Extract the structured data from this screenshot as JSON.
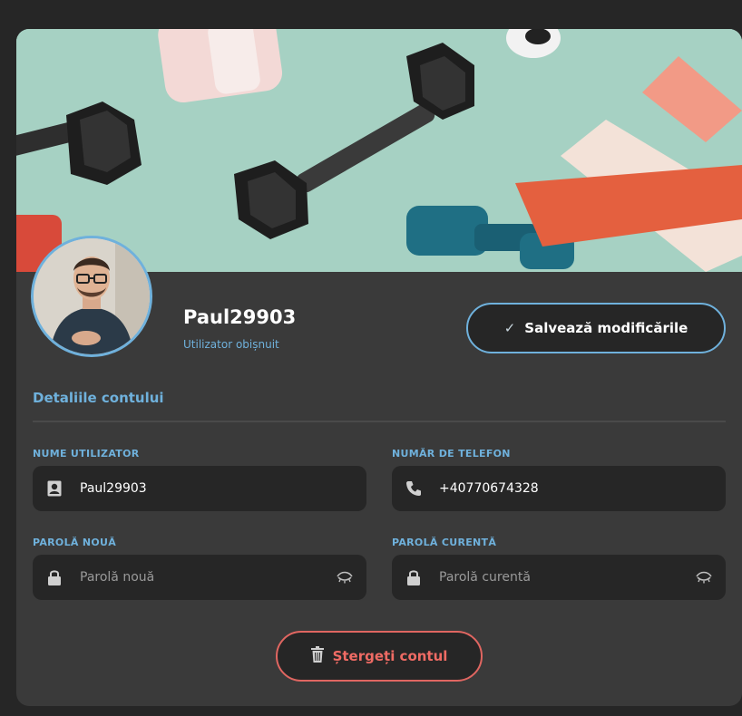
{
  "profile": {
    "username": "Paul29903",
    "role": "Utilizator obișnuit"
  },
  "actions": {
    "save_label": "Salvează modificările",
    "delete_label": "Ștergeți contul"
  },
  "section": {
    "title": "Detaliile contului"
  },
  "fields": {
    "username": {
      "label": "NUME UTILIZATOR",
      "value": "Paul29903",
      "icon": "contact-card-icon"
    },
    "phone": {
      "label": "NUMĂR DE TELEFON",
      "value": "+40770674328",
      "icon": "phone-icon"
    },
    "new_password": {
      "label": "PAROLĂ NOUĂ",
      "placeholder": "Parolă nouă",
      "value": "",
      "icon": "lock-icon"
    },
    "current_password": {
      "label": "PAROLĂ CURENTĂ",
      "placeholder": "Parolă curentă",
      "value": "",
      "icon": "lock-icon"
    }
  },
  "colors": {
    "accent": "#6fb1dc",
    "danger": "#e06661",
    "card": "#3a3a3a",
    "field": "#262626"
  }
}
